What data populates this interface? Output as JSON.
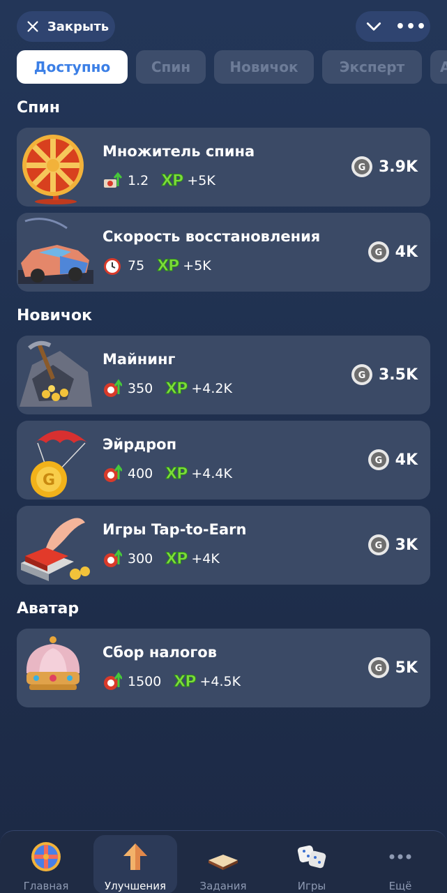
{
  "header": {
    "close_label": "Закрыть",
    "menu_more": "•••"
  },
  "tabs": [
    {
      "label": "Доступно",
      "active": true
    },
    {
      "label": "Спин",
      "active": false
    },
    {
      "label": "Новичок",
      "active": false
    },
    {
      "label": "Эксперт",
      "active": false
    },
    {
      "label": "А",
      "active": false
    }
  ],
  "sections": {
    "spin": "Спин",
    "newbie": "Новичок",
    "avatar": "Аватар"
  },
  "cards": [
    {
      "title": "Множитель спина",
      "stat_icon": "multiplier-icon",
      "stat_value": "1.2",
      "xp_label": "XP",
      "xp_value": "+5K",
      "price": "3.9K"
    },
    {
      "title": "Скорость восстановления",
      "stat_icon": "alarm-clock-icon",
      "stat_value": "75",
      "xp_label": "XP",
      "xp_value": "+5K",
      "price": "4K"
    },
    {
      "title": "Майнинг",
      "stat_icon": "chip-up-icon",
      "stat_value": "350",
      "xp_label": "XP",
      "xp_value": "+4.2K",
      "price": "3.5K"
    },
    {
      "title": "Эйрдроп",
      "stat_icon": "chip-up-icon",
      "stat_value": "400",
      "xp_label": "XP",
      "xp_value": "+4.4K",
      "price": "4K"
    },
    {
      "title": "Игры Tap-to-Earn",
      "stat_icon": "chip-up-icon",
      "stat_value": "300",
      "xp_label": "XP",
      "xp_value": "+4K",
      "price": "3K"
    },
    {
      "title": "Сбор налогов",
      "stat_icon": "chip-up-icon",
      "stat_value": "1500",
      "xp_label": "XP",
      "xp_value": "+4.5K",
      "price": "5K"
    }
  ],
  "nav": [
    {
      "label": "Главная",
      "icon": "wheel-icon",
      "active": false
    },
    {
      "label": "Улучшения",
      "icon": "upgrade-arrow-icon",
      "active": true
    },
    {
      "label": "Задания",
      "icon": "book-icon",
      "active": false
    },
    {
      "label": "Игры",
      "icon": "dice-icon",
      "active": false
    },
    {
      "label": "Ещё",
      "icon": "more-dots-icon",
      "active": false
    }
  ],
  "colors": {
    "background": "#233658",
    "card": "#3b4a66",
    "tab_active_text": "#3b7fe6",
    "xp_green": "#7ddc3a"
  }
}
